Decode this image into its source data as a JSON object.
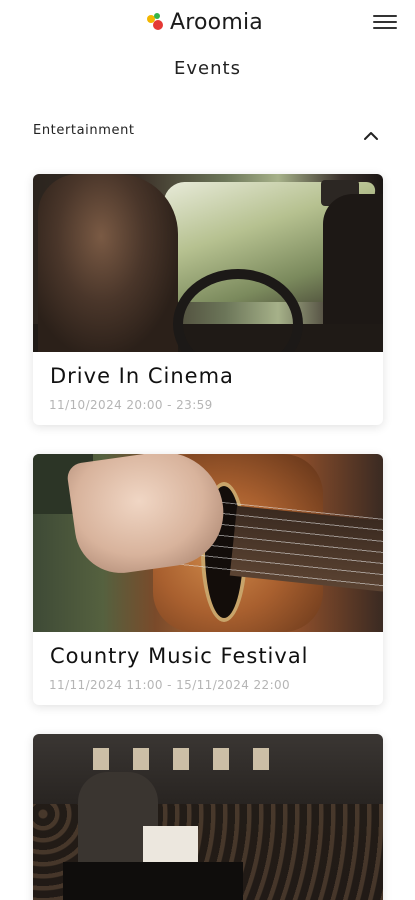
{
  "header": {
    "brand": "Aroomia",
    "menu_icon": "hamburger-menu-icon"
  },
  "page": {
    "title": "Events"
  },
  "section": {
    "label": "Entertainment",
    "toggle_icon": "chevron-up-icon",
    "expanded": true
  },
  "events": [
    {
      "title": "Drive In Cinema",
      "date": "11/10/2024 20:00 - 23:59",
      "image": "car-interior-photo"
    },
    {
      "title": "Country Music Festival",
      "date": "11/11/2024 11:00 - 15/11/2024 22:00",
      "image": "guitar-photo"
    },
    {
      "title": "",
      "date": "",
      "image": "concert-photo"
    }
  ],
  "colors": {
    "logo_dots": [
      "#f2b600",
      "#35b44a",
      "#e53935"
    ],
    "date_text": "#b5b5b5"
  }
}
